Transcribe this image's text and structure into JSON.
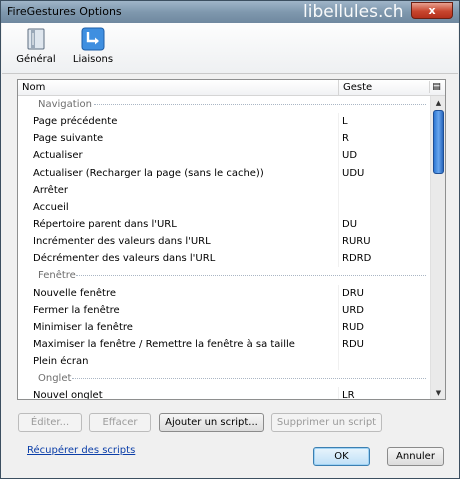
{
  "window": {
    "title": "FireGestures Options",
    "watermark": "libellules.ch",
    "close_label": "x"
  },
  "toolbar": {
    "general": {
      "label": "Général",
      "icon": "general-settings-icon"
    },
    "bindings": {
      "label": "Liaisons",
      "icon": "bindings-icon"
    }
  },
  "list": {
    "col_name": "Nom",
    "col_gesture": "Geste",
    "rows": [
      {
        "name": "Navigation",
        "group": true
      },
      {
        "name": "Page précédente",
        "gesture": "L"
      },
      {
        "name": "Page suivante",
        "gesture": "R"
      },
      {
        "name": "Actualiser",
        "gesture": "UD"
      },
      {
        "name": "Actualiser (Recharger la page (sans le cache))",
        "gesture": "UDU"
      },
      {
        "name": "Arrêter",
        "gesture": ""
      },
      {
        "name": "Accueil",
        "gesture": ""
      },
      {
        "name": "Répertoire parent dans l'URL",
        "gesture": "DU"
      },
      {
        "name": "Incrémenter des valeurs dans l'URL",
        "gesture": "RURU"
      },
      {
        "name": "Décrémenter des valeurs dans l'URL",
        "gesture": "RDRD"
      },
      {
        "name": "Fenêtre",
        "group": true
      },
      {
        "name": "Nouvelle fenêtre",
        "gesture": "DRU"
      },
      {
        "name": "Fermer la fenêtre",
        "gesture": "URD"
      },
      {
        "name": "Minimiser la fenêtre",
        "gesture": "RUD"
      },
      {
        "name": "Maximiser la fenêtre / Remettre la fenêtre à sa taille",
        "gesture": "RDU"
      },
      {
        "name": "Plein écran",
        "gesture": ""
      },
      {
        "name": "Onglet",
        "group": true
      },
      {
        "name": "Nouvel onglet",
        "gesture": "LR"
      }
    ]
  },
  "buttons": {
    "edit": "Éditer...",
    "delete": "Effacer",
    "add_script": "Ajouter un script...",
    "remove_script": "Supprimer un script",
    "ok": "OK",
    "cancel": "Annuler"
  },
  "link": {
    "recover_scripts": "Récupérer des scripts"
  },
  "colors": {
    "accent": "#2d77d3",
    "link": "#0b3ea8",
    "title_bar": "#7f98ae"
  }
}
